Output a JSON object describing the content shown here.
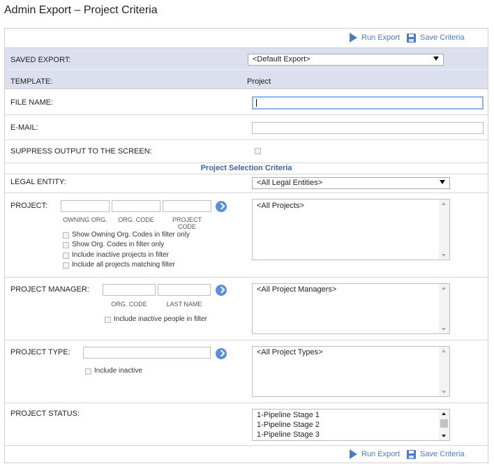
{
  "page_title": "Admin Export – Project Criteria",
  "toolbar": {
    "run_export": "Run Export",
    "save_criteria": "Save Criteria"
  },
  "saved_export": {
    "label": "SAVED EXPORT:",
    "value": "<Default Export>"
  },
  "template": {
    "label": "TEMPLATE:",
    "value": "Project"
  },
  "file_name": {
    "label": "FILE NAME:",
    "value": ""
  },
  "email": {
    "label": "E-MAIL:",
    "value": ""
  },
  "suppress": {
    "label": "SUPPRESS OUTPUT TO THE SCREEN:"
  },
  "section_title": "Project Selection Criteria",
  "legal_entity": {
    "label": "LEGAL ENTITY:",
    "value": "<All Legal Entities>"
  },
  "project": {
    "label": "PROJECT:",
    "col_owning_org": "OWNING ORG.",
    "col_org_code": "ORG. CODE",
    "col_project_code": "PROJECT CODE",
    "checkboxes": [
      "Show Owning Org. Codes in filter only",
      "Show Org. Codes in filter only",
      "Include inactive projects in filter",
      "Include all projects matching filter"
    ],
    "list": [
      "<All Projects>"
    ]
  },
  "project_manager": {
    "label": "PROJECT MANAGER:",
    "col_org_code": "ORG. CODE",
    "col_last_name": "LAST NAME",
    "checkbox": "Include inactive people in filter",
    "list": [
      "<All Project Managers>"
    ]
  },
  "project_type": {
    "label": "PROJECT TYPE:",
    "checkbox": "Include inactive",
    "list": [
      "<All Project Types>"
    ]
  },
  "project_status": {
    "label": "PROJECT STATUS:",
    "list": [
      "1-Pipeline Stage 1",
      "1-Pipeline Stage 2",
      "1-Pipeline Stage 3"
    ]
  },
  "colors": {
    "header_band": "#dcdfee",
    "accent": "#4a7cc4",
    "section_title": "#3b63a6"
  }
}
